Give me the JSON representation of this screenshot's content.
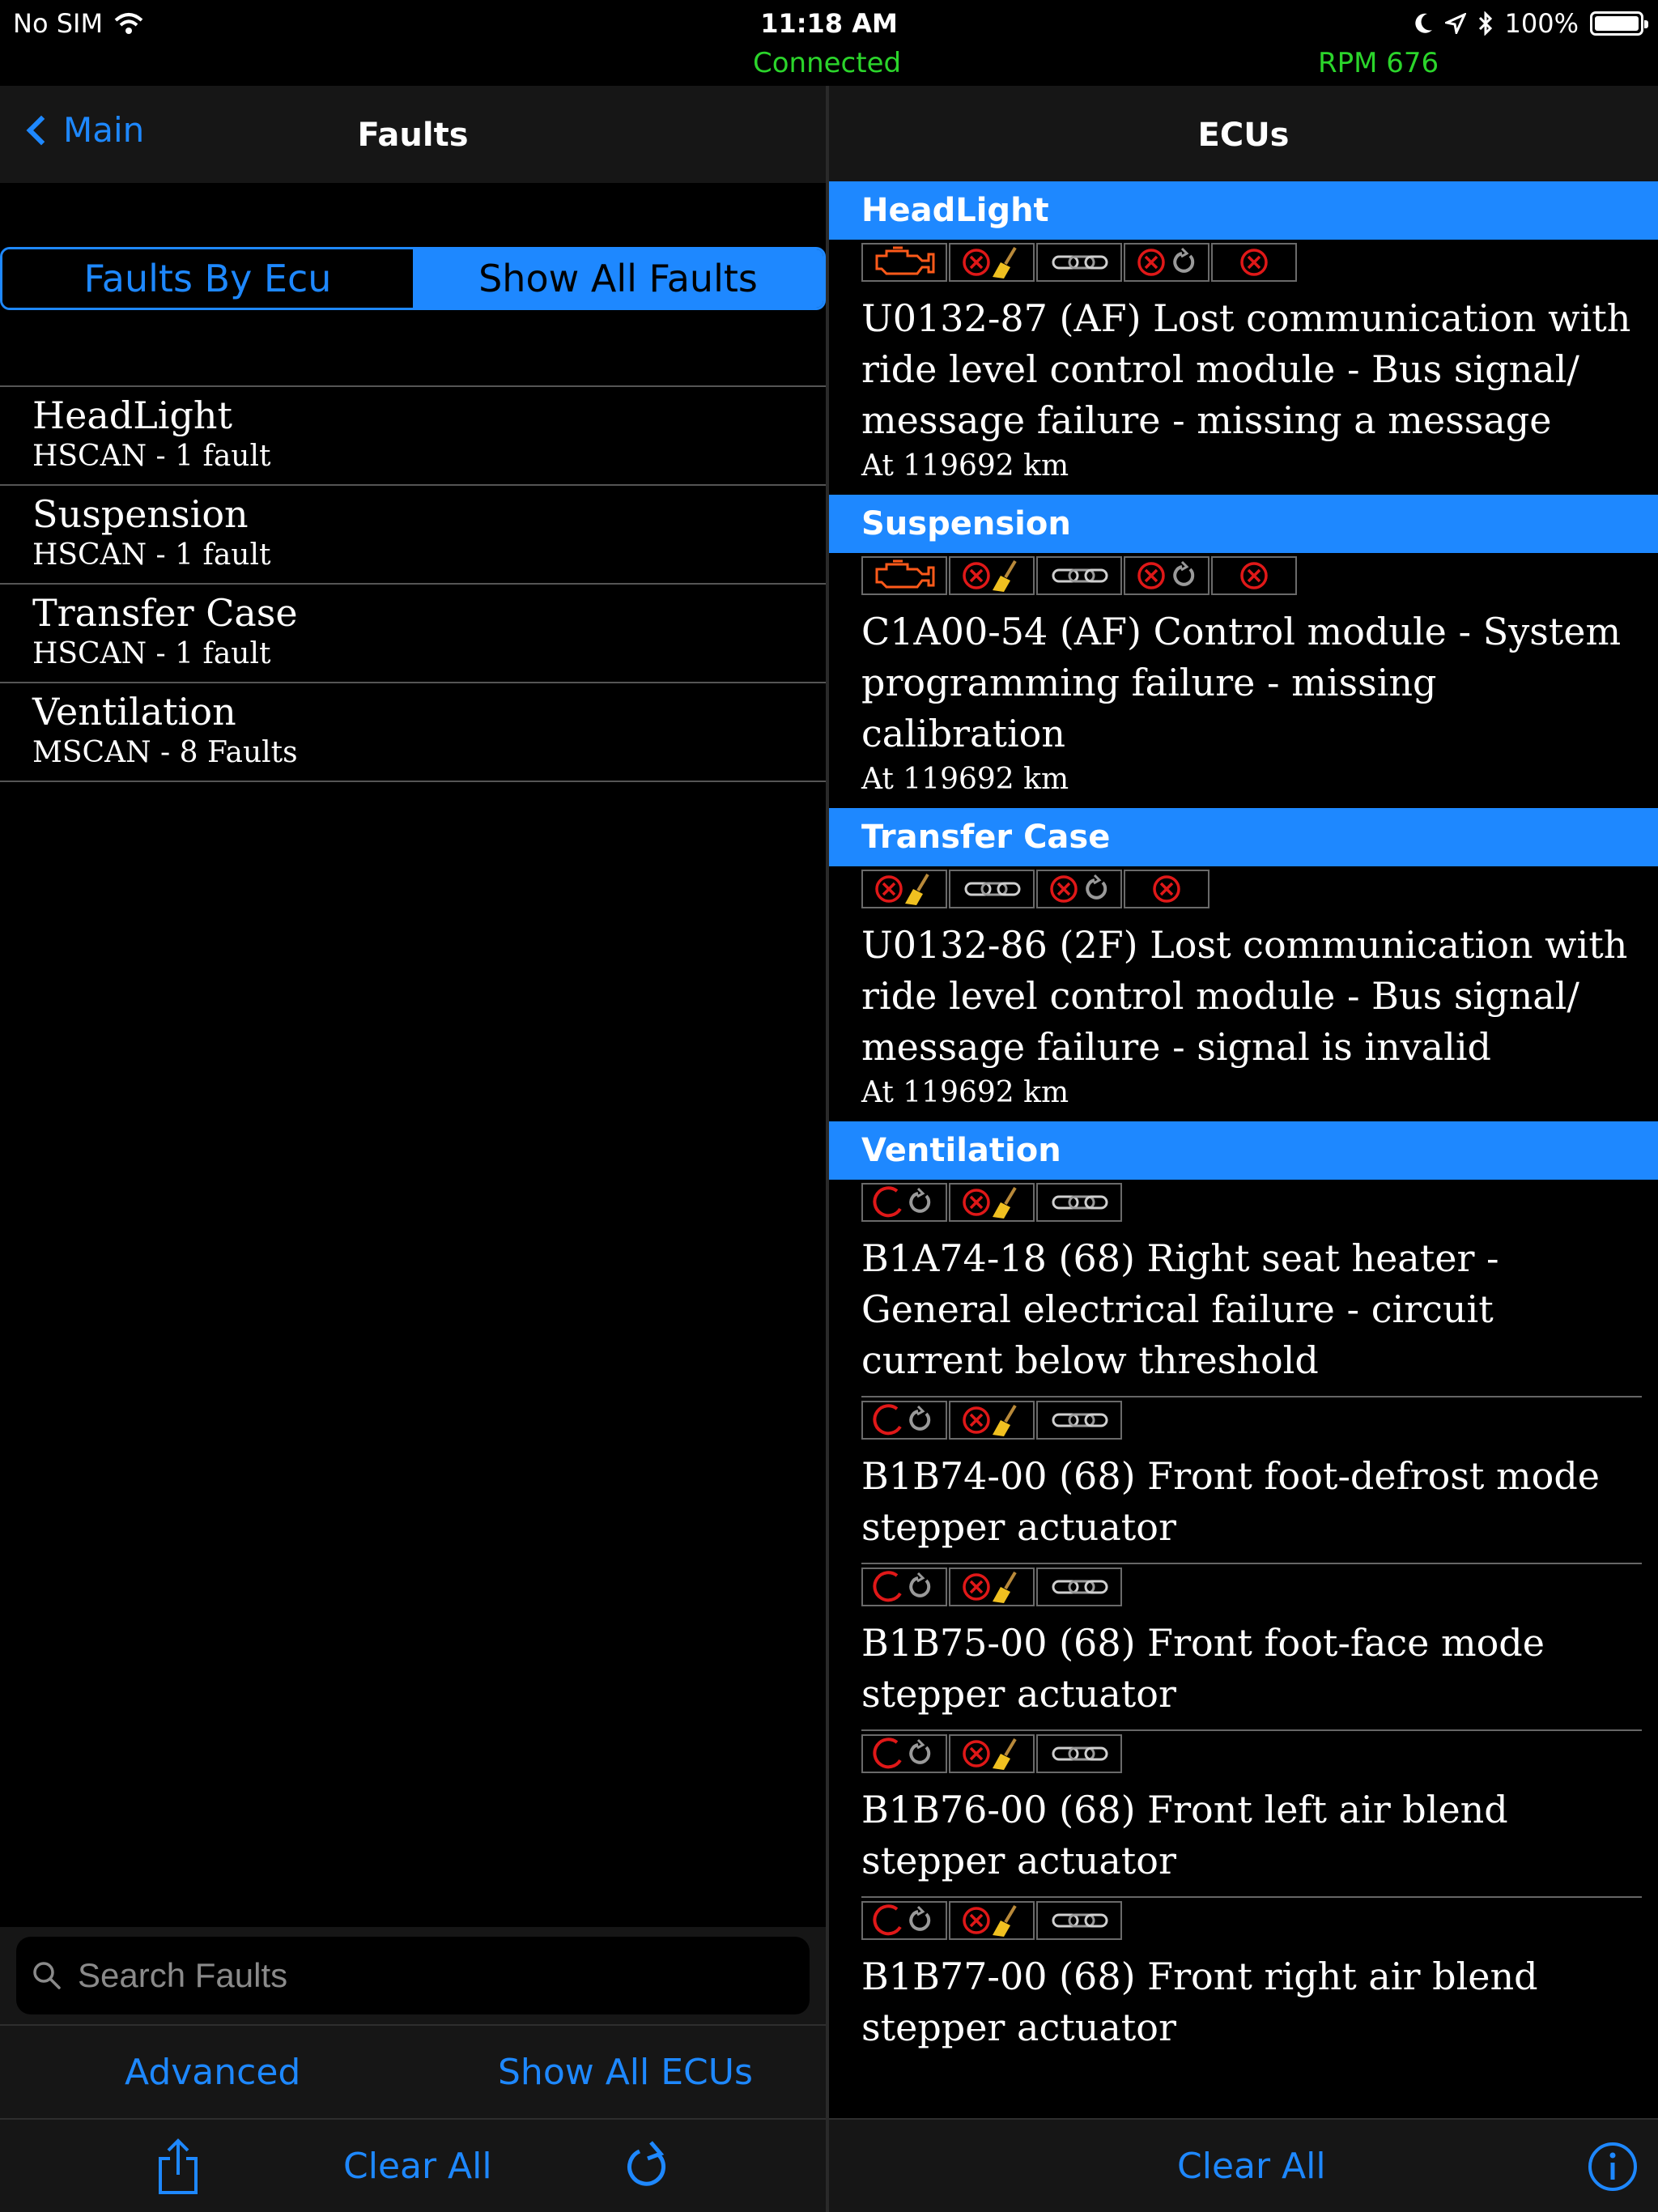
{
  "status_bar": {
    "carrier": "No SIM",
    "time": "11:18 AM",
    "battery": "100%",
    "connection": "Connected",
    "rpm": "RPM 676"
  },
  "left": {
    "back_label": "Main",
    "title": "Faults",
    "segments": [
      "Faults By Ecu",
      "Show All Faults"
    ],
    "ecus": [
      {
        "name": "HeadLight",
        "sub": "HSCAN - 1 fault"
      },
      {
        "name": "Suspension",
        "sub": "HSCAN - 1 fault"
      },
      {
        "name": "Transfer Case",
        "sub": "HSCAN - 1 fault"
      },
      {
        "name": "Ventilation",
        "sub": "MSCAN - 8 Faults"
      }
    ],
    "search_placeholder": "Search Faults",
    "advanced_label": "Advanced",
    "show_all_ecus_label": "Show All ECUs",
    "clear_all_label": "Clear All"
  },
  "right": {
    "title": "ECUs",
    "clear_all_label": "Clear All",
    "sections": [
      {
        "name": "HeadLight",
        "faults": [
          {
            "icons": [
              "engine-icon",
              "clear-broom-icon",
              "link-icon",
              "error-cycle-icon",
              "error-icon"
            ],
            "text": "U0132-87 (AF) Lost communication with ride level control module - Bus signal/ message failure - missing a message",
            "km": "At 119692 km"
          }
        ]
      },
      {
        "name": "Suspension",
        "faults": [
          {
            "icons": [
              "engine-icon",
              "clear-broom-icon",
              "link-icon",
              "error-cycle-icon",
              "error-icon"
            ],
            "text": "C1A00-54 (AF) Control module - System programming failure - missing calibration",
            "km": "At 119692 km"
          }
        ]
      },
      {
        "name": "Transfer Case",
        "faults": [
          {
            "icons": [
              "clear-broom-icon",
              "link-icon",
              "error-cycle-icon",
              "error-icon"
            ],
            "text": "U0132-86 (2F) Lost communication with ride level control module - Bus signal/ message failure - signal is invalid",
            "km": "At 119692 km"
          }
        ]
      },
      {
        "name": "Ventilation",
        "faults": [
          {
            "icons": [
              "pending-cycle-icon",
              "clear-broom-icon",
              "link-icon"
            ],
            "text": "B1A74-18 (68) Right seat heater - General electrical failure - circuit current below threshold",
            "km": ""
          },
          {
            "icons": [
              "pending-cycle-icon",
              "clear-broom-icon",
              "link-icon"
            ],
            "text": "B1B74-00 (68) Front foot-defrost mode stepper actuator",
            "km": ""
          },
          {
            "icons": [
              "pending-cycle-icon",
              "clear-broom-icon",
              "link-icon"
            ],
            "text": "B1B75-00 (68) Front foot-face mode stepper actuator",
            "km": ""
          },
          {
            "icons": [
              "pending-cycle-icon",
              "clear-broom-icon",
              "link-icon"
            ],
            "text": "B1B76-00 (68) Front left air blend stepper actuator",
            "km": ""
          },
          {
            "icons": [
              "pending-cycle-icon",
              "clear-broom-icon",
              "link-icon"
            ],
            "text": "B1B77-00 (68) Front right air blend stepper actuator",
            "km": ""
          }
        ]
      }
    ]
  },
  "colors": {
    "accent": "#1e88ff",
    "connected": "#2bd52b",
    "error": "#e01818",
    "engine": "#ff5a1a"
  }
}
